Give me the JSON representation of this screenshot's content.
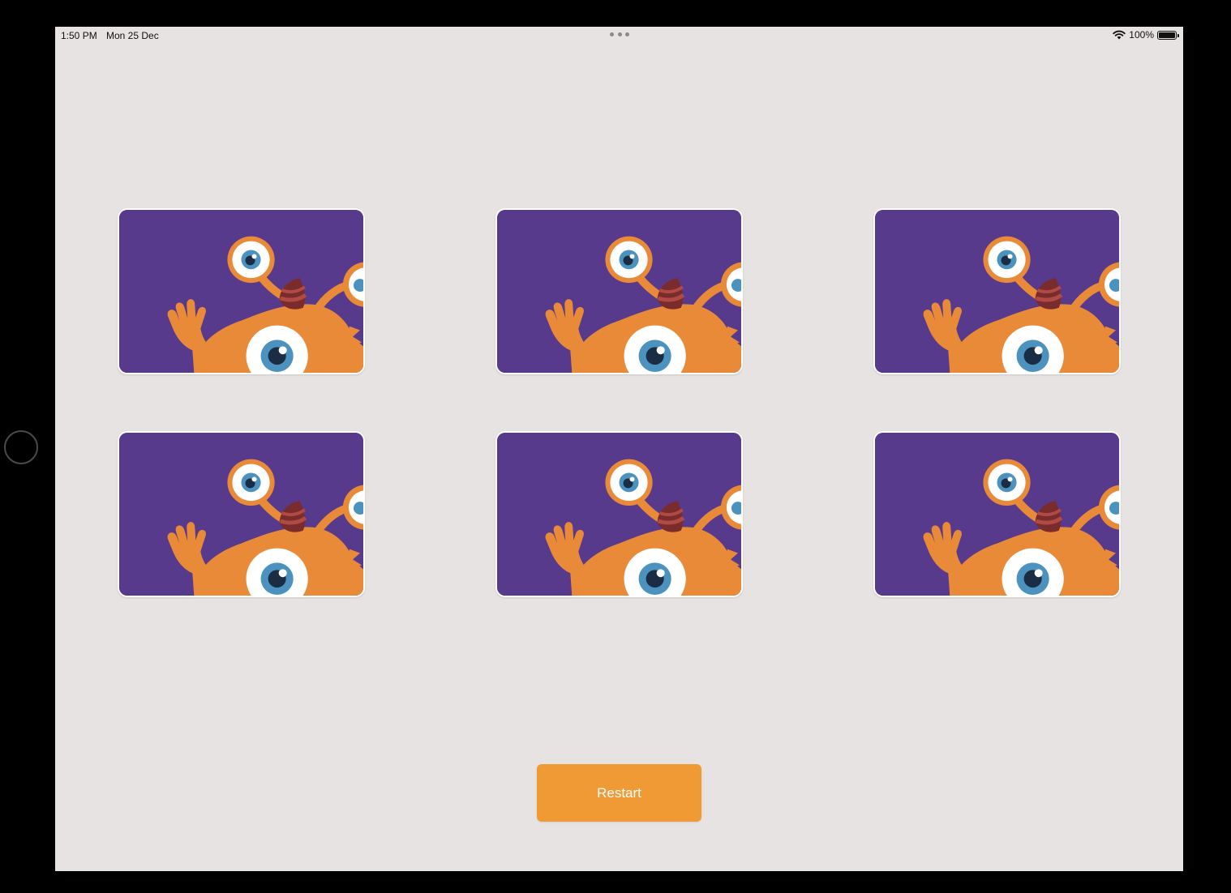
{
  "status_bar": {
    "time": "1:50 PM",
    "date": "Mon 25 Dec",
    "battery": "100%",
    "battery_level": 1.0,
    "icons": [
      "wifi-icon",
      "battery-icon"
    ]
  },
  "colors": {
    "screen_background": "#e6e3e2",
    "card_back_background": "#583a8c",
    "monster_body": "#e98a39",
    "eye_iris": "#4b93be",
    "restart_button": "#f09a36"
  },
  "cards": [
    {
      "face": "monster-card-back"
    },
    {
      "face": "monster-card-back"
    },
    {
      "face": "monster-card-back"
    },
    {
      "face": "monster-card-back"
    },
    {
      "face": "monster-card-back"
    },
    {
      "face": "monster-card-back"
    }
  ],
  "restart_button": {
    "label": "Restart"
  }
}
